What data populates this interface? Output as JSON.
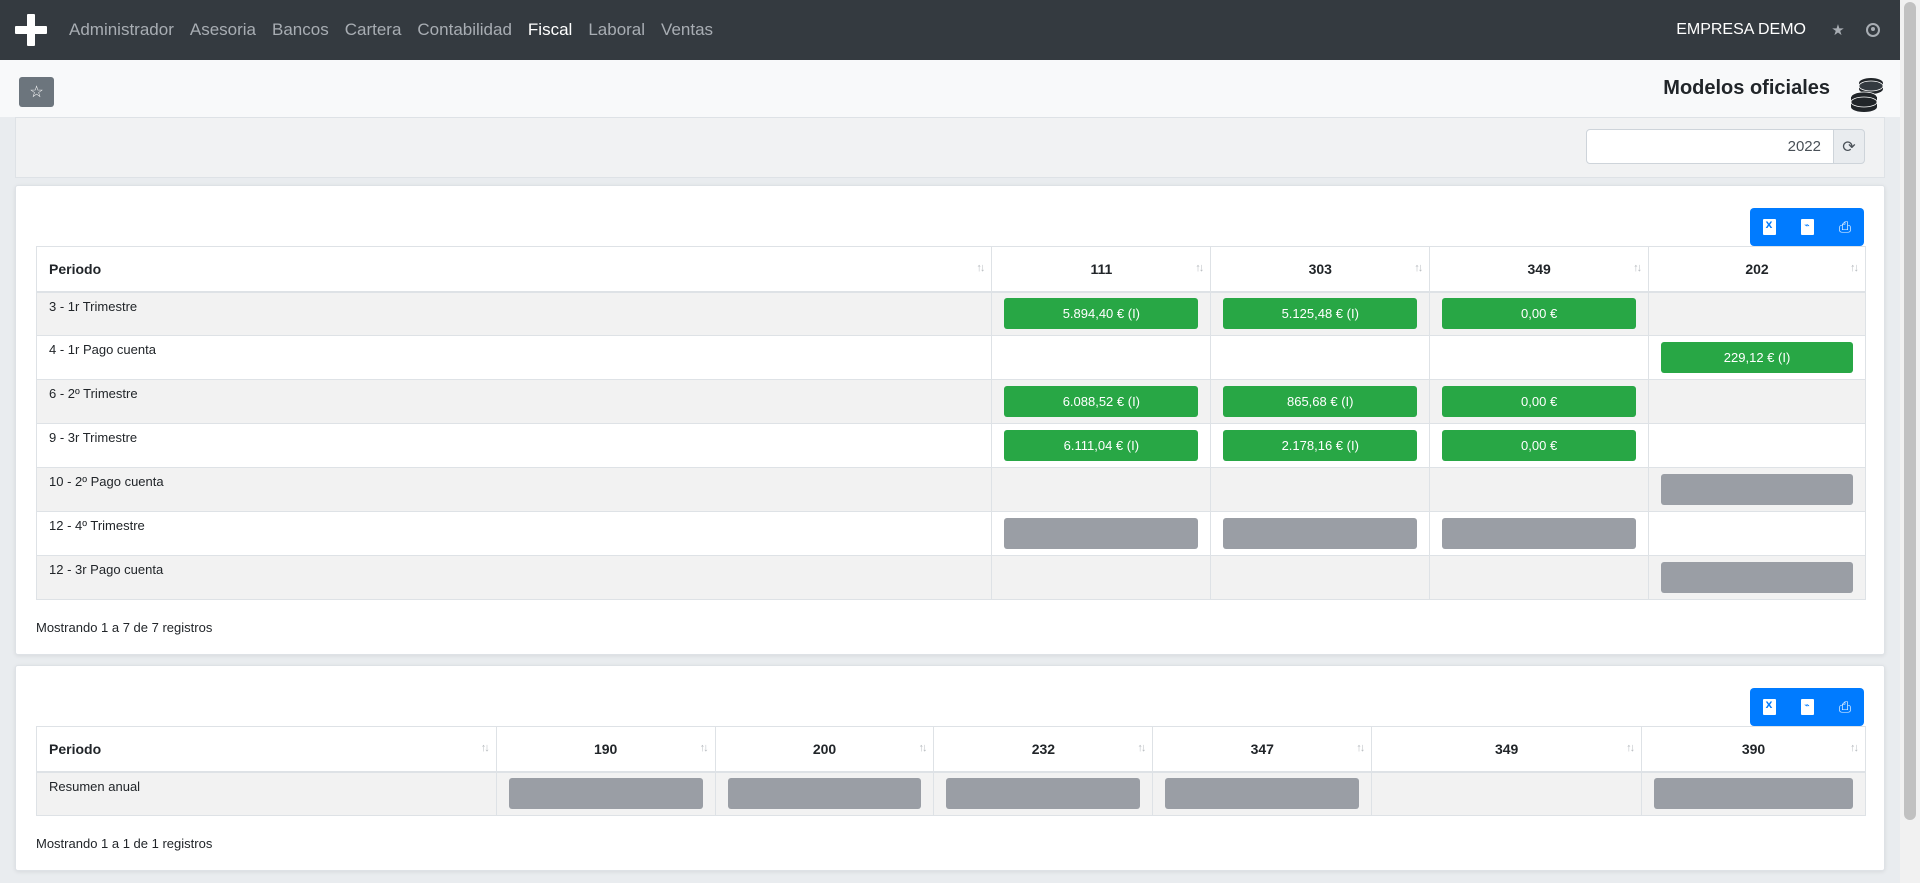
{
  "navbar": {
    "items": [
      "Administrador",
      "Asesoria",
      "Bancos",
      "Cartera",
      "Contabilidad",
      "Fiscal",
      "Laboral",
      "Ventas"
    ],
    "active": "Fiscal",
    "company": "EMPRESA DEMO"
  },
  "header": {
    "title": "Modelos oficiales"
  },
  "filter": {
    "year": "2022"
  },
  "table1": {
    "columns": [
      "Periodo",
      "111",
      "303",
      "349",
      "202"
    ],
    "rows": [
      {
        "period": "3 - 1r Trimestre",
        "cells": [
          {
            "v": "5.894,40 € (I)",
            "s": "green"
          },
          {
            "v": "5.125,48 € (I)",
            "s": "green"
          },
          {
            "v": "0,00 €",
            "s": "green"
          },
          null
        ]
      },
      {
        "period": "4 - 1r Pago cuenta",
        "cells": [
          null,
          null,
          null,
          {
            "v": "229,12 € (I)",
            "s": "green"
          }
        ]
      },
      {
        "period": "6 - 2º Trimestre",
        "cells": [
          {
            "v": "6.088,52 € (I)",
            "s": "green"
          },
          {
            "v": "865,68 € (I)",
            "s": "green"
          },
          {
            "v": "0,00 €",
            "s": "green"
          },
          null
        ]
      },
      {
        "period": "9 - 3r Trimestre",
        "cells": [
          {
            "v": "6.111,04 € (I)",
            "s": "green"
          },
          {
            "v": "2.178,16 € (I)",
            "s": "green"
          },
          {
            "v": "0,00 €",
            "s": "green"
          },
          null
        ]
      },
      {
        "period": "10 - 2º Pago cuenta",
        "cells": [
          null,
          null,
          null,
          {
            "v": "",
            "s": "grey"
          }
        ]
      },
      {
        "period": "12 - 4º Trimestre",
        "cells": [
          {
            "v": "",
            "s": "grey"
          },
          {
            "v": "",
            "s": "grey"
          },
          {
            "v": "",
            "s": "grey"
          },
          null
        ]
      },
      {
        "period": "12 - 3r Pago cuenta",
        "cells": [
          null,
          null,
          null,
          {
            "v": "",
            "s": "grey"
          }
        ]
      }
    ],
    "info": "Mostrando 1 a 7 de 7 registros"
  },
  "table2": {
    "columns": [
      "Periodo",
      "190",
      "200",
      "232",
      "347",
      "349",
      "390"
    ],
    "rows": [
      {
        "period": "Resumen anual",
        "cells": [
          {
            "v": "",
            "s": "grey"
          },
          {
            "v": "",
            "s": "grey"
          },
          {
            "v": "",
            "s": "grey"
          },
          {
            "v": "",
            "s": "grey"
          },
          null,
          {
            "v": "",
            "s": "grey"
          }
        ]
      }
    ],
    "info": "Mostrando 1 a 1 de 1 registros"
  },
  "colors": {
    "navbar": "#343a40",
    "primary": "#007bff",
    "success": "#28a745",
    "secondary": "#9a9ea5"
  },
  "icons": {
    "export": [
      "file-excel-icon",
      "file-pdf-icon",
      "print-icon"
    ],
    "favorite": "star-icon",
    "refresh": "refresh-icon",
    "title": "coins-icon"
  }
}
